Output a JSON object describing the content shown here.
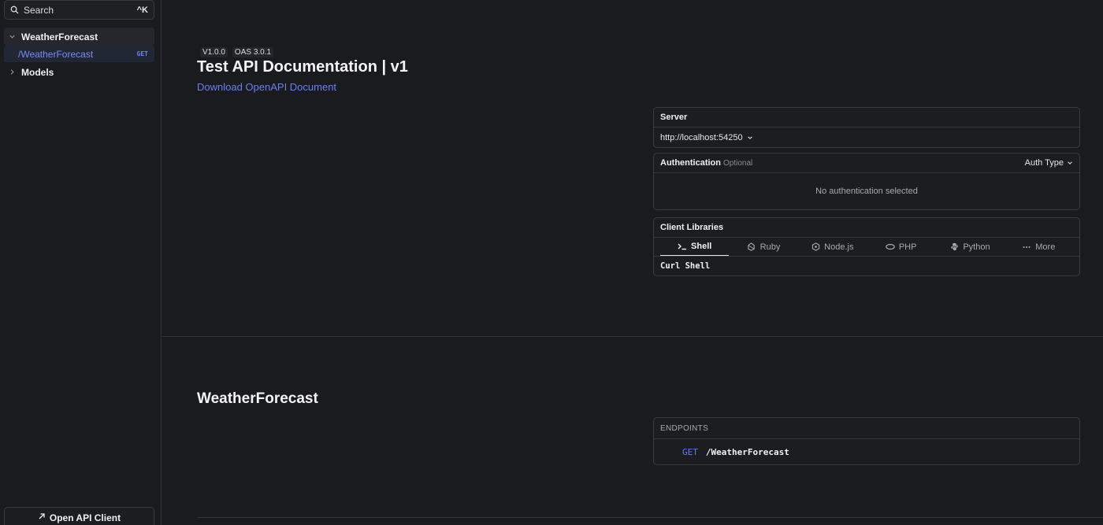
{
  "sidebar": {
    "search": {
      "label": "Search",
      "shortcut": "^K"
    },
    "groups": [
      {
        "label": "WeatherForecast",
        "expanded": true,
        "items": [
          {
            "label": "/WeatherForecast",
            "method": "GET"
          }
        ]
      },
      {
        "label": "Models",
        "expanded": false
      }
    ],
    "open_client_label": "Open API Client"
  },
  "header": {
    "version": "V1.0.0",
    "oas": "OAS 3.0.1",
    "title": "Test API Documentation | v1",
    "download_link": "Download OpenAPI Document"
  },
  "server": {
    "title": "Server",
    "url": "http://localhost:54250"
  },
  "authentication": {
    "title": "Authentication",
    "optional": "Optional",
    "auth_type": "Auth Type",
    "empty": "No authentication selected"
  },
  "client_libraries": {
    "title": "Client Libraries",
    "tabs": [
      {
        "label": "Shell",
        "icon": "terminal-icon",
        "active": true
      },
      {
        "label": "Ruby",
        "icon": "ruby-icon"
      },
      {
        "label": "Node.js",
        "icon": "nodejs-icon"
      },
      {
        "label": "PHP",
        "icon": "php-icon"
      },
      {
        "label": "Python",
        "icon": "python-icon"
      },
      {
        "label": "More",
        "icon": "more-icon"
      }
    ],
    "selected_client": "Curl Shell"
  },
  "section": {
    "title": "WeatherForecast",
    "endpoints_label": "ENDPOINTS",
    "endpoints": [
      {
        "method": "GET",
        "path": "/WeatherForecast"
      }
    ]
  },
  "colors": {
    "background": "#1a1b1f",
    "accent": "#6b7ff0",
    "border": "#3a3b40"
  }
}
